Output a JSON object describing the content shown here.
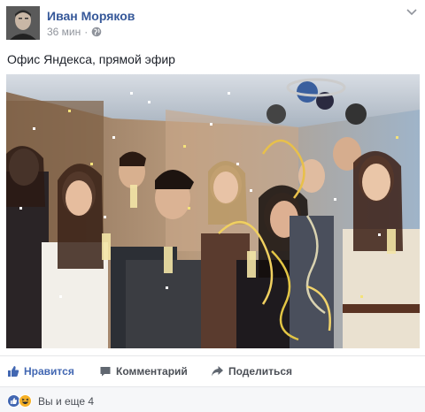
{
  "post": {
    "author": "Иван Моряков",
    "time": "36 мин",
    "time_separator": "·",
    "text": "Офис Яндекса, прямой эфир",
    "photo_alt": "Фото"
  },
  "actions": {
    "like": "Нравится",
    "comment": "Комментарий",
    "share": "Поделиться"
  },
  "reactions": {
    "summary": "Вы и еще 4",
    "icons": [
      "like-reaction-icon",
      "haha-reaction-icon"
    ]
  },
  "colors": {
    "author": "#365899",
    "like_active": "#4267b2",
    "meta": "#90949c",
    "action_text": "#4b4f56"
  }
}
